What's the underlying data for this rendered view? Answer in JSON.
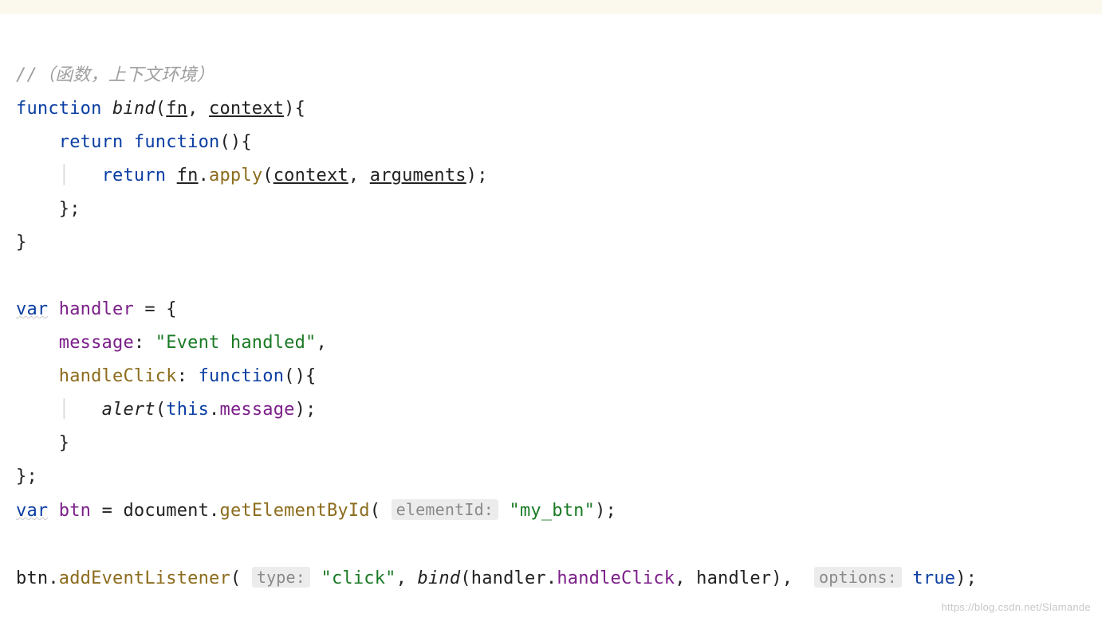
{
  "topbar": {},
  "code": {
    "l1_comment": "//（函数，上下文环境）",
    "kw_function": "function",
    "fn_bind": "bind",
    "param_fn": "fn",
    "param_context": "context",
    "kw_return": "return",
    "method_apply": "apply",
    "param_arguments": "arguments",
    "kw_var": "var",
    "id_handler": "handler",
    "prop_message": "message",
    "str_event_handled": "\"Event handled\"",
    "prop_handleClick": "handleClick",
    "fn_alert": "alert",
    "kw_this": "this",
    "id_btn": "btn",
    "id_document": "document",
    "method_getElementById": "getElementById",
    "hint_elementId": "elementId:",
    "str_my_btn": "\"my_btn\"",
    "method_addEventListener": "addEventListener",
    "hint_type": "type:",
    "str_click": "\"click\"",
    "hint_options": "options:",
    "bool_true": "true",
    "guide1": "│",
    "guide2": "│   │"
  },
  "watermark": "https://blog.csdn.net/Slamande"
}
